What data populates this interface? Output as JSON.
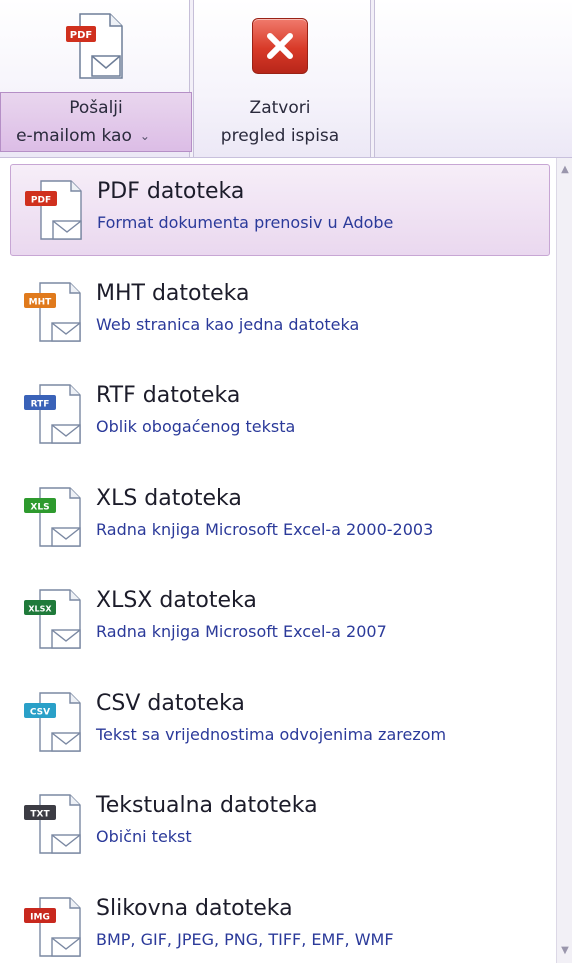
{
  "ribbon": {
    "send_label_line1": "Pošalji",
    "send_label_line2": "e-mailom kao",
    "close_label_line1": "Zatvori",
    "close_label_line2": "pregled ispisa",
    "pdf_badge": "PDF"
  },
  "menu": {
    "items": [
      {
        "badge": "PDF",
        "badge_color": "#d0301e",
        "title": "PDF datoteka",
        "description": "Format dokumenta prenosiv u Adobe",
        "icon": "pdf-file-icon"
      },
      {
        "badge": "MHT",
        "badge_color": "#e07a1c",
        "title": "MHT datoteka",
        "description": "Web stranica kao jedna datoteka",
        "icon": "mht-file-icon"
      },
      {
        "badge": "RTF",
        "badge_color": "#3a62b8",
        "title": "RTF datoteka",
        "description": "Oblik obogaćenog teksta",
        "icon": "rtf-file-icon"
      },
      {
        "badge": "XLS",
        "badge_color": "#2e9a2e",
        "title": "XLS datoteka",
        "description": "Radna knjiga Microsoft Excel-a 2000-2003",
        "icon": "xls-file-icon"
      },
      {
        "badge": "XLSX",
        "badge_color": "#1f7a3a",
        "title": "XLSX datoteka",
        "description": "Radna knjiga Microsoft Excel-a 2007",
        "icon": "xlsx-file-icon"
      },
      {
        "badge": "CSV",
        "badge_color": "#2aa0c8",
        "title": "CSV datoteka",
        "description": "Tekst sa vrijednostima odvojenima zarezom",
        "icon": "csv-file-icon"
      },
      {
        "badge": "TXT",
        "badge_color": "#3c3c44",
        "title": "Tekstualna datoteka",
        "description": "Obični tekst",
        "icon": "txt-file-icon"
      },
      {
        "badge": "IMG",
        "badge_color": "#c8281e",
        "title": "Slikovna datoteka",
        "description": "BMP, GIF, JPEG, PNG, TIFF, EMF, WMF",
        "icon": "image-file-icon"
      }
    ]
  }
}
